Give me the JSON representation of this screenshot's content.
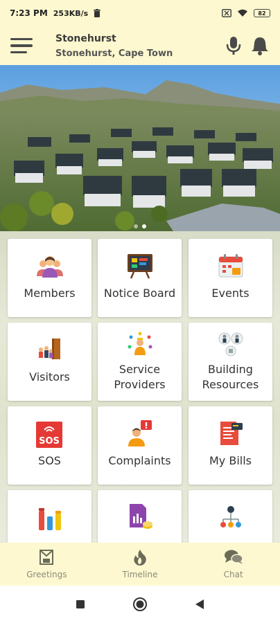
{
  "status": {
    "time": "7:23 PM",
    "speed": "253KB/s",
    "battery": "82"
  },
  "header": {
    "title": "Stonehurst",
    "subtitle": "Stonehurst, Cape Town"
  },
  "banner": {
    "slides": 2,
    "active_slide": 2
  },
  "tiles": [
    {
      "label": "Members",
      "icon": "members-icon"
    },
    {
      "label": "Notice Board",
      "icon": "notice-board-icon"
    },
    {
      "label": "Events",
      "icon": "events-icon"
    },
    {
      "label": "Visitors",
      "icon": "visitors-icon"
    },
    {
      "label_lines": [
        "Service",
        "Providers"
      ],
      "icon": "service-providers-icon"
    },
    {
      "label_lines": [
        "Building",
        "Resources"
      ],
      "icon": "building-resources-icon"
    },
    {
      "label": "SOS",
      "icon": "sos-icon"
    },
    {
      "label": "Complaints",
      "icon": "complaints-icon"
    },
    {
      "label": "My Bills",
      "icon": "my-bills-icon"
    },
    {
      "label": "",
      "icon": "polls-icon"
    },
    {
      "label": "",
      "icon": "documents-icon"
    },
    {
      "label": "",
      "icon": "directory-icon"
    }
  ],
  "bottom_nav": [
    {
      "label": "Greetings",
      "icon": "greetings-icon"
    },
    {
      "label": "Timeline",
      "icon": "timeline-icon"
    },
    {
      "label": "Chat",
      "icon": "chat-icon"
    }
  ],
  "colors": {
    "app_bar": "#fdf8cf",
    "accent_red": "#d32f2f",
    "nav_text": "#8a8a7a"
  }
}
